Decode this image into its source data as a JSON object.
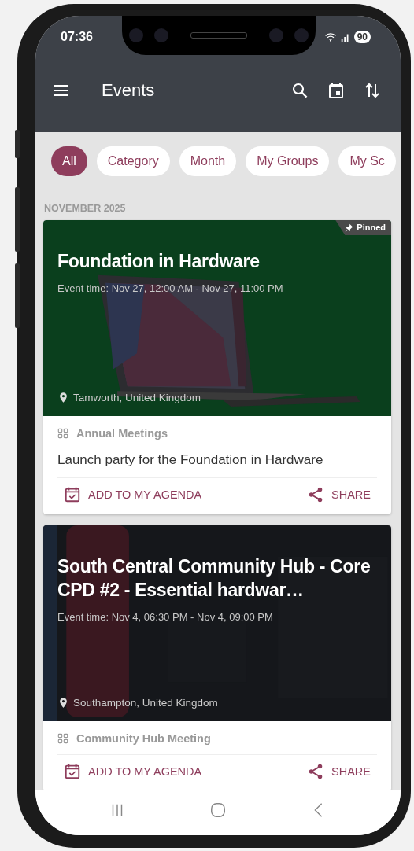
{
  "status_bar": {
    "time": "07:36",
    "battery": "90"
  },
  "app_bar": {
    "title": "Events"
  },
  "filters": [
    {
      "label": "All",
      "selected": true
    },
    {
      "label": "Category",
      "selected": false
    },
    {
      "label": "Month",
      "selected": false
    },
    {
      "label": "My Groups",
      "selected": false
    },
    {
      "label": "My Sc",
      "selected": false
    }
  ],
  "section": "NOVEMBER 2025",
  "events": [
    {
      "title": "Foundation in Hardware",
      "time": "Event time: Nov 27, 12:00 AM - Nov 27, 11:00 PM",
      "location": "Tamworth, United Kingdom",
      "pinned": true,
      "pin_label": "Pinned",
      "category": "Annual Meetings",
      "description": "Launch party for the Foundation in Hardware",
      "add_label": "ADD TO MY AGENDA",
      "share_label": "SHARE"
    },
    {
      "title": "South Central Community Hub - Core CPD #2 - Essential hardwar…",
      "time": "Event time: Nov 4, 06:30 PM - Nov 4, 09:00 PM",
      "location": "Southampton, United Kingdom",
      "pinned": false,
      "category": "Community Hub Meeting",
      "add_label": "ADD TO MY AGENDA",
      "share_label": "SHARE"
    }
  ]
}
